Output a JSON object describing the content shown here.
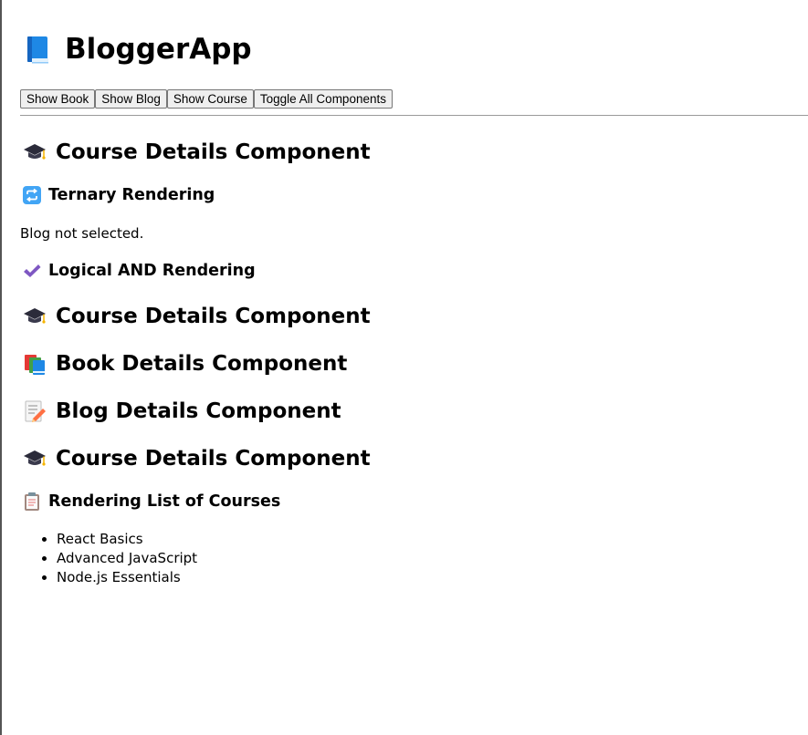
{
  "app": {
    "title": "BloggerApp",
    "title_icon": "blue-book-icon"
  },
  "toolbar": {
    "show_book_label": "Show Book",
    "show_blog_label": "Show Blog",
    "show_course_label": "Show Course",
    "toggle_all_label": "Toggle All Components"
  },
  "sections": {
    "course_top": {
      "title": "Course Details Component",
      "icon": "graduation-cap-icon"
    },
    "ternary": {
      "title": "Ternary Rendering",
      "icon": "repeat-arrows-icon"
    },
    "blog_status": "Blog not selected.",
    "logical_and": {
      "title": "Logical AND Rendering",
      "icon": "check-mark-icon"
    },
    "course_and": {
      "title": "Course Details Component",
      "icon": "graduation-cap-icon"
    },
    "book": {
      "title": "Book Details Component",
      "icon": "books-icon"
    },
    "blog": {
      "title": "Blog Details Component",
      "icon": "memo-icon"
    },
    "course_bottom": {
      "title": "Course Details Component",
      "icon": "graduation-cap-icon"
    },
    "course_list": {
      "title": "Rendering List of Courses",
      "icon": "clipboard-icon",
      "items": [
        "React Basics",
        "Advanced JavaScript",
        "Node.js Essentials"
      ]
    }
  },
  "colors": {
    "book_blue": "#1e88e5",
    "check_purple": "#7e57c2",
    "repeat_blue": "#42a5f5",
    "divider": "#9a9a9a"
  }
}
